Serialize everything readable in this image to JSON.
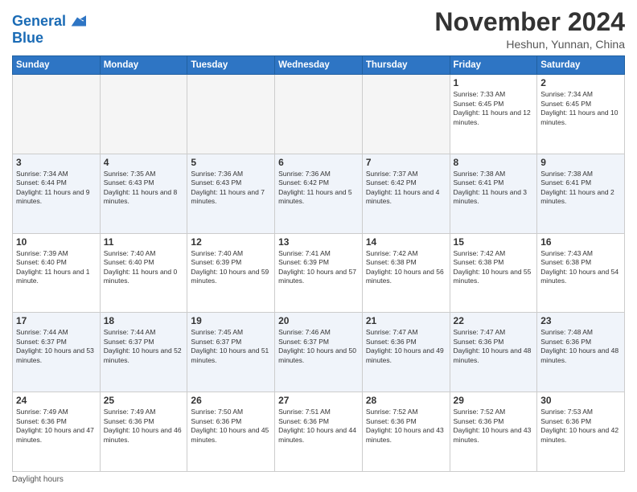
{
  "header": {
    "logo_line1": "General",
    "logo_line2": "Blue",
    "month_title": "November 2024",
    "location": "Heshun, Yunnan, China"
  },
  "days_of_week": [
    "Sunday",
    "Monday",
    "Tuesday",
    "Wednesday",
    "Thursday",
    "Friday",
    "Saturday"
  ],
  "weeks": [
    [
      {
        "day": "",
        "info": ""
      },
      {
        "day": "",
        "info": ""
      },
      {
        "day": "",
        "info": ""
      },
      {
        "day": "",
        "info": ""
      },
      {
        "day": "",
        "info": ""
      },
      {
        "day": "1",
        "info": "Sunrise: 7:33 AM\nSunset: 6:45 PM\nDaylight: 11 hours and 12 minutes."
      },
      {
        "day": "2",
        "info": "Sunrise: 7:34 AM\nSunset: 6:45 PM\nDaylight: 11 hours and 10 minutes."
      }
    ],
    [
      {
        "day": "3",
        "info": "Sunrise: 7:34 AM\nSunset: 6:44 PM\nDaylight: 11 hours and 9 minutes."
      },
      {
        "day": "4",
        "info": "Sunrise: 7:35 AM\nSunset: 6:43 PM\nDaylight: 11 hours and 8 minutes."
      },
      {
        "day": "5",
        "info": "Sunrise: 7:36 AM\nSunset: 6:43 PM\nDaylight: 11 hours and 7 minutes."
      },
      {
        "day": "6",
        "info": "Sunrise: 7:36 AM\nSunset: 6:42 PM\nDaylight: 11 hours and 5 minutes."
      },
      {
        "day": "7",
        "info": "Sunrise: 7:37 AM\nSunset: 6:42 PM\nDaylight: 11 hours and 4 minutes."
      },
      {
        "day": "8",
        "info": "Sunrise: 7:38 AM\nSunset: 6:41 PM\nDaylight: 11 hours and 3 minutes."
      },
      {
        "day": "9",
        "info": "Sunrise: 7:38 AM\nSunset: 6:41 PM\nDaylight: 11 hours and 2 minutes."
      }
    ],
    [
      {
        "day": "10",
        "info": "Sunrise: 7:39 AM\nSunset: 6:40 PM\nDaylight: 11 hours and 1 minute."
      },
      {
        "day": "11",
        "info": "Sunrise: 7:40 AM\nSunset: 6:40 PM\nDaylight: 11 hours and 0 minutes."
      },
      {
        "day": "12",
        "info": "Sunrise: 7:40 AM\nSunset: 6:39 PM\nDaylight: 10 hours and 59 minutes."
      },
      {
        "day": "13",
        "info": "Sunrise: 7:41 AM\nSunset: 6:39 PM\nDaylight: 10 hours and 57 minutes."
      },
      {
        "day": "14",
        "info": "Sunrise: 7:42 AM\nSunset: 6:38 PM\nDaylight: 10 hours and 56 minutes."
      },
      {
        "day": "15",
        "info": "Sunrise: 7:42 AM\nSunset: 6:38 PM\nDaylight: 10 hours and 55 minutes."
      },
      {
        "day": "16",
        "info": "Sunrise: 7:43 AM\nSunset: 6:38 PM\nDaylight: 10 hours and 54 minutes."
      }
    ],
    [
      {
        "day": "17",
        "info": "Sunrise: 7:44 AM\nSunset: 6:37 PM\nDaylight: 10 hours and 53 minutes."
      },
      {
        "day": "18",
        "info": "Sunrise: 7:44 AM\nSunset: 6:37 PM\nDaylight: 10 hours and 52 minutes."
      },
      {
        "day": "19",
        "info": "Sunrise: 7:45 AM\nSunset: 6:37 PM\nDaylight: 10 hours and 51 minutes."
      },
      {
        "day": "20",
        "info": "Sunrise: 7:46 AM\nSunset: 6:37 PM\nDaylight: 10 hours and 50 minutes."
      },
      {
        "day": "21",
        "info": "Sunrise: 7:47 AM\nSunset: 6:36 PM\nDaylight: 10 hours and 49 minutes."
      },
      {
        "day": "22",
        "info": "Sunrise: 7:47 AM\nSunset: 6:36 PM\nDaylight: 10 hours and 48 minutes."
      },
      {
        "day": "23",
        "info": "Sunrise: 7:48 AM\nSunset: 6:36 PM\nDaylight: 10 hours and 48 minutes."
      }
    ],
    [
      {
        "day": "24",
        "info": "Sunrise: 7:49 AM\nSunset: 6:36 PM\nDaylight: 10 hours and 47 minutes."
      },
      {
        "day": "25",
        "info": "Sunrise: 7:49 AM\nSunset: 6:36 PM\nDaylight: 10 hours and 46 minutes."
      },
      {
        "day": "26",
        "info": "Sunrise: 7:50 AM\nSunset: 6:36 PM\nDaylight: 10 hours and 45 minutes."
      },
      {
        "day": "27",
        "info": "Sunrise: 7:51 AM\nSunset: 6:36 PM\nDaylight: 10 hours and 44 minutes."
      },
      {
        "day": "28",
        "info": "Sunrise: 7:52 AM\nSunset: 6:36 PM\nDaylight: 10 hours and 43 minutes."
      },
      {
        "day": "29",
        "info": "Sunrise: 7:52 AM\nSunset: 6:36 PM\nDaylight: 10 hours and 43 minutes."
      },
      {
        "day": "30",
        "info": "Sunrise: 7:53 AM\nSunset: 6:36 PM\nDaylight: 10 hours and 42 minutes."
      }
    ]
  ],
  "footer": {
    "note": "Daylight hours"
  }
}
